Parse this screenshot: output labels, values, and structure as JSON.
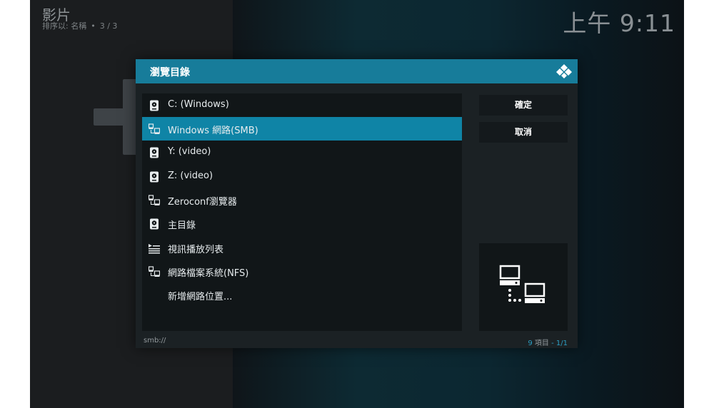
{
  "background": {
    "section_title": "影片",
    "sort_prefix": "排序以: 名稱",
    "page_position": "3 / 3",
    "clock": "上午 9:11"
  },
  "dialog": {
    "title": "瀏覽目錄",
    "items": [
      {
        "label": "C: (Windows)",
        "icon": "hard-drive-icon",
        "selected": false
      },
      {
        "label": "Windows 網路(SMB)",
        "icon": "network-icon",
        "selected": true
      },
      {
        "label": "Y: (video)",
        "icon": "hard-drive-icon",
        "selected": false
      },
      {
        "label": "Z: (video)",
        "icon": "hard-drive-icon",
        "selected": false
      },
      {
        "label": "Zeroconf瀏覽器",
        "icon": "network-icon",
        "selected": false
      },
      {
        "label": "主目錄",
        "icon": "hard-drive-icon",
        "selected": false
      },
      {
        "label": "視訊播放列表",
        "icon": "playlist-icon",
        "selected": false
      },
      {
        "label": "網路檔案系統(NFS)",
        "icon": "network-icon",
        "selected": false
      },
      {
        "label": "新增網路位置...",
        "icon": "",
        "selected": false
      }
    ],
    "ok_label": "確定",
    "cancel_label": "取消",
    "path": "smb://",
    "item_count": "9",
    "item_word": "項目",
    "separator": "-",
    "page": "1/1"
  },
  "colors": {
    "accent": "#177c9a",
    "selection": "#0f84a6"
  }
}
